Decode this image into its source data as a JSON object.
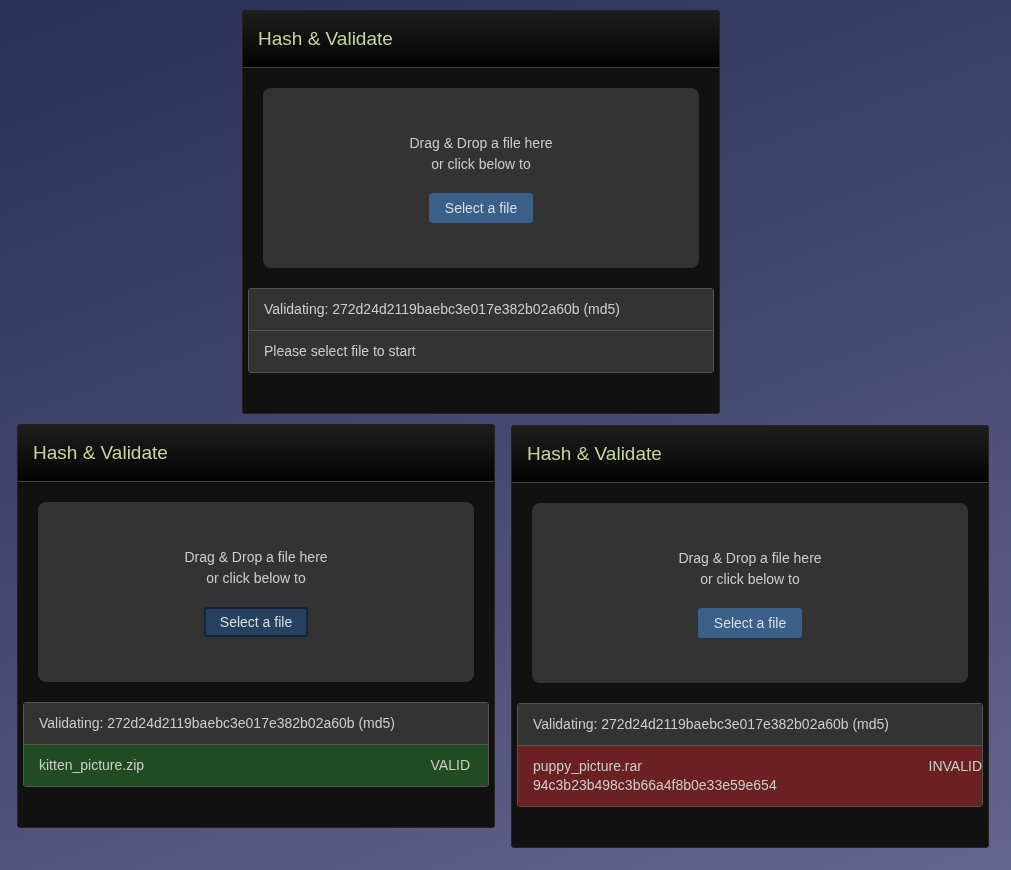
{
  "windows": [
    {
      "title": "Hash & Validate",
      "drop_lines": [
        "Drag & Drop a file here",
        "or click below to"
      ],
      "button": {
        "label": "Select a file",
        "pressed": false
      },
      "validating": "Validating: 272d24d2119baebc3e017e382b02a60b (md5)",
      "result": {
        "kind": "idle",
        "message": "Please select file to start"
      }
    },
    {
      "title": "Hash & Validate",
      "drop_lines": [
        "Drag & Drop a file here",
        "or click below to"
      ],
      "button": {
        "label": "Select a file",
        "pressed": true
      },
      "validating": "Validating: 272d24d2119baebc3e017e382b02a60b (md5)",
      "result": {
        "kind": "valid",
        "file": "kitten_picture.zip",
        "status": "VALID"
      }
    },
    {
      "title": "Hash & Validate",
      "drop_lines": [
        "Drag & Drop a file here",
        "or click below to"
      ],
      "button": {
        "label": "Select a file",
        "pressed": false
      },
      "validating": "Validating: 272d24d2119baebc3e017e382b02a60b (md5)",
      "result": {
        "kind": "invalid",
        "file": "puppy_picture.rar",
        "hash": "94c3b23b498c3b66a4f8b0e33e59e654",
        "status": "INVALID"
      }
    }
  ]
}
